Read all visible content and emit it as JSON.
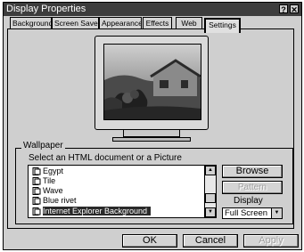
{
  "window": {
    "title": "Display Properties"
  },
  "titlebar": {
    "help_label": "?",
    "close_label": "✕"
  },
  "tabs": [
    {
      "label": "Background"
    },
    {
      "label": "Screen Saver"
    },
    {
      "label": "Appearance"
    },
    {
      "label": "Effects"
    },
    {
      "label": "Web"
    },
    {
      "label": "Settings"
    }
  ],
  "wallpaper": {
    "group_label": "Wallpaper",
    "select_label": "Select an HTML document or a Picture",
    "items": [
      {
        "label": "Egypt"
      },
      {
        "label": "Tile"
      },
      {
        "label": "Wave"
      },
      {
        "label": "Blue rivet"
      },
      {
        "label": "Internet Explorer  Background"
      }
    ],
    "browse_label": "Browse",
    "pattern_label": "Pattern",
    "display_label": "Display",
    "display_value": "Full Screen"
  },
  "footer": {
    "ok_label": "OK",
    "cancel_label": "Cancel",
    "apply_label": "Apply"
  }
}
